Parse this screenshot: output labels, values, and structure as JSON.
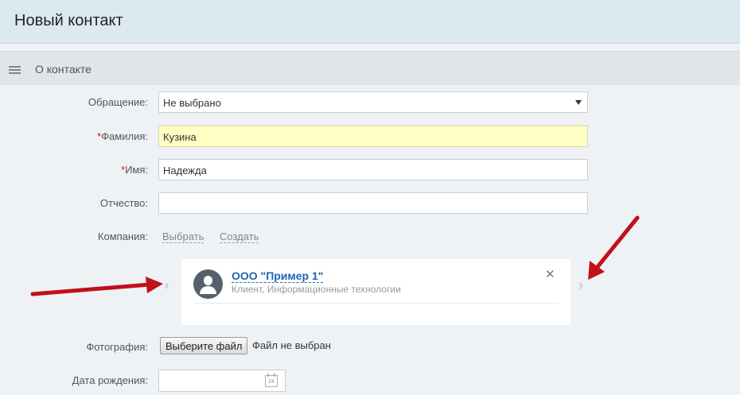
{
  "page": {
    "title": "Новый контакт"
  },
  "section": {
    "title": "О контакте"
  },
  "form": {
    "salutation_label": "Обращение:",
    "salutation_value": "Не выбрано",
    "required_mark": "*",
    "lastname_label": "Фамилия:",
    "lastname_value": "Кузина",
    "firstname_label": "Имя:",
    "firstname_value": "Надежда",
    "middlename_label": "Отчество:",
    "middlename_value": "",
    "company_label": "Компания:",
    "company_select_link": "Выбрать",
    "company_create_link": "Создать",
    "photo_label": "Фотография:",
    "photo_button": "Выберите файл",
    "photo_status": "Файл не выбран",
    "birthdate_label": "Дата рождения:",
    "birthdate_value": "",
    "calendar_day": "24"
  },
  "company_card": {
    "name": "ООО \"Пример 1\"",
    "subtitle": "Клиент, Информационные технологии",
    "close_glyph": "✕",
    "prev_glyph": "‹",
    "next_glyph": "›"
  },
  "colors": {
    "header_bg": "#dde9f1",
    "section_bg": "#e0e5e8",
    "required_field_bg": "#ffffc4",
    "link_blue": "#2067b0",
    "annotation_arrow": "#c0101a"
  },
  "icons": [
    "hamburger-menu-icon",
    "chevron-down-icon",
    "user-avatar-icon",
    "close-icon",
    "chevron-left-icon",
    "chevron-right-icon",
    "calendar-icon",
    "annotation-arrow-icon"
  ]
}
